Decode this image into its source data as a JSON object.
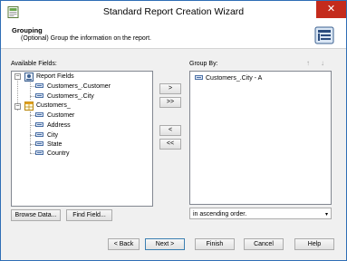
{
  "window": {
    "title": "Standard Report Creation Wizard",
    "close_glyph": "✕"
  },
  "header": {
    "title": "Grouping",
    "description": "(Optional) Group the information on the report."
  },
  "available": {
    "label": "Available Fields:",
    "tree": [
      {
        "label": "Report Fields",
        "icon": "report-fields-icon",
        "expanded": true,
        "children": [
          "Customers_.Customer",
          "Customers_.City"
        ]
      },
      {
        "label": "Customers_",
        "icon": "table-icon",
        "expanded": true,
        "children": [
          "Customer",
          "Address",
          "City",
          "State",
          "Country"
        ]
      }
    ]
  },
  "transfer_buttons": {
    "add_one": ">",
    "add_all": ">>",
    "remove_one": "<",
    "remove_all": "<<"
  },
  "group_by": {
    "label": "Group By:",
    "items": [
      "Customers_.City - A"
    ],
    "sort_up": "↑",
    "sort_down": "↓",
    "order_value": "in ascending order."
  },
  "actions": {
    "browse_data": "Browse Data...",
    "find_field": "Find Field...",
    "back": "< Back",
    "next": "Next >",
    "finish": "Finish",
    "cancel": "Cancel",
    "help": "Help"
  }
}
